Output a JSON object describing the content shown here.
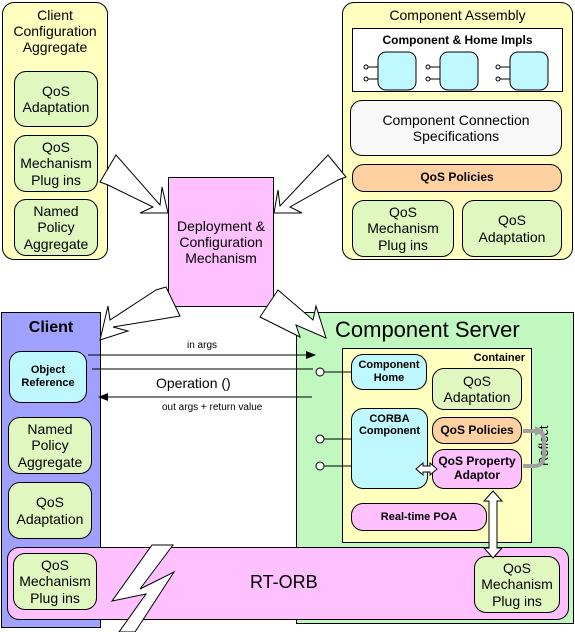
{
  "client_config": {
    "title": "Client Configuration Aggregate",
    "items": [
      "QoS Adaptation",
      "QoS Mechanism Plug ins",
      "Named Policy Aggregate"
    ]
  },
  "assembly": {
    "title": "Component Assembly",
    "impls_title": "Component & Home Impls",
    "connection_specs": "Component Connection Specifications",
    "qos_policies": "QoS Policies",
    "mechanism": "QoS Mechanism Plug ins",
    "adaptation": "QoS Adaptation"
  },
  "deployment": {
    "label": "Deployment & Configuration Mechanism"
  },
  "client": {
    "title": "Client",
    "object_reference": "Object Reference",
    "named_policy": "Named Policy Aggregate",
    "adaptation": "QoS Adaptation",
    "mechanism": "QoS Mechanism Plug ins"
  },
  "calls": {
    "in_args": "in args",
    "operation": "Operation ()",
    "out_args": "out args + return value"
  },
  "server": {
    "title": "Component Server",
    "container": "Container",
    "component_home": "Component Home",
    "adaptation": "QoS Adaptation",
    "corba_component": "CORBA Component",
    "qos_policies": "QoS Policies",
    "property_adaptor": "QoS Property Adaptor",
    "reflect": "Reflect",
    "rt_poa": "Real-time POA",
    "mechanism": "QoS Mechanism Plug ins"
  },
  "orb": {
    "label": "RT-ORB"
  }
}
